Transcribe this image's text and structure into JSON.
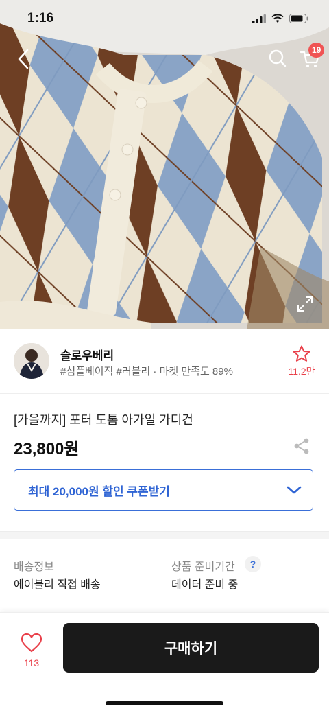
{
  "status_bar": {
    "time": "1:16",
    "icons": [
      "signal-icon",
      "wifi-icon",
      "battery-icon"
    ]
  },
  "nav": {
    "icons": [
      "back-icon",
      "search-icon",
      "cart-icon"
    ],
    "cart_badge": "19"
  },
  "hero": {
    "icons": [
      "expand-icon"
    ]
  },
  "seller": {
    "name": "슬로우베리",
    "meta": "#심플베이직 #러블리 · 마켓 만족도 89%",
    "favorite_count": "11.2만"
  },
  "product": {
    "name": "[가을까지] 포터 도톰 아가일 가디건",
    "price": "23,800원"
  },
  "coupon": {
    "label": "최대 20,000원 할인 쿠폰받기"
  },
  "shipping": {
    "label": "배송정보",
    "value": "에이블리 직접 배송",
    "prep_label": "상품 준비기간",
    "prep_help": "?",
    "prep_value": "데이터 준비 중"
  },
  "bottom": {
    "like_count": "113",
    "buy_label": "구매하기"
  },
  "colors": {
    "accent_blue": "#2f64d4",
    "badge_red": "#f05454",
    "like_red": "#e9404a",
    "buy_button": "#1a1a1a"
  }
}
